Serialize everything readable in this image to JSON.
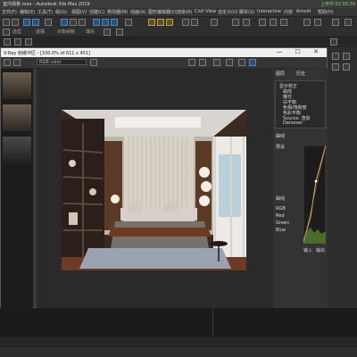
{
  "app": {
    "title": "室内场景.max - Autodesk 3ds Max 2019",
    "status": "上传中 02:55:39"
  },
  "menubar": {
    "items": [
      "文件(F)",
      "编辑(E)",
      "工具(T)",
      "组(G)",
      "视图(V)",
      "创建(C)",
      "修改器(M)",
      "动画(A)",
      "图形编辑器(D)",
      "渲染(R)",
      "Civil View",
      "自定义(U)",
      "脚本(S)",
      "Interactive",
      "内容",
      "Arnold",
      "帮助(H)"
    ]
  },
  "toolbar2": {
    "items": [
      "造型",
      "选择",
      "对象绘制",
      "填充"
    ]
  },
  "vfb": {
    "title": "V-Ray 帧缓冲区 - [100.0% of 611 x 451]",
    "menu": [
      "文件",
      "视图",
      "渲染",
      "图像",
      "帮助"
    ],
    "channel": "RGB color",
    "window_buttons": "— ☐ ✕",
    "right_tabs": [
      "图层",
      "历史"
    ],
    "layers": [
      "显示校正",
      "曲线",
      "曝光",
      "白平衡",
      "色相/饱和度",
      "色彩平衡",
      "Source: 渲染",
      "Denoiser"
    ],
    "section_label": "曲线",
    "curve_labels": [
      "输入",
      "输出"
    ],
    "left_buttons": [
      "预设",
      "曲线",
      "RGB",
      "Red",
      "Green",
      "Blue"
    ]
  }
}
